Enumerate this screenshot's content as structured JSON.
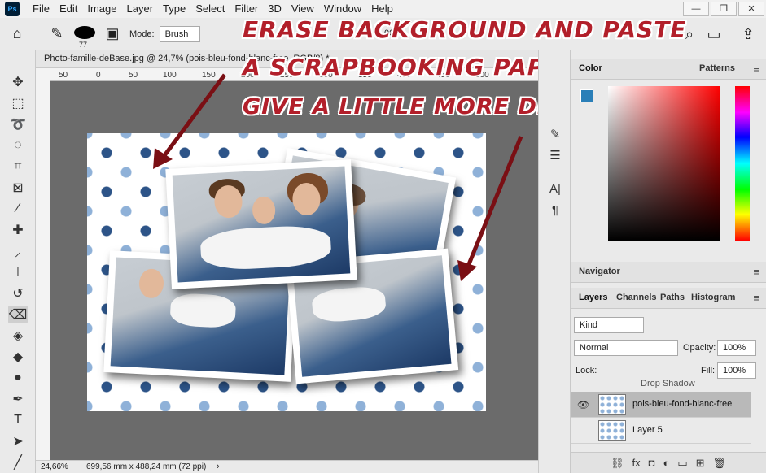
{
  "app": {
    "logo": "Ps"
  },
  "menu": [
    "File",
    "Edit",
    "Image",
    "Layer",
    "Type",
    "Select",
    "Filter",
    "3D",
    "View",
    "Window",
    "Help"
  ],
  "window_controls": {
    "minimize": "—",
    "restore": "❐",
    "close": "✕"
  },
  "options_bar": {
    "home_icon": "home-icon",
    "tool_icon": "eraser-icon",
    "brush_size": "77",
    "mode_label": "Mode:",
    "mode_value": "Brush",
    "flow_fragment": "00"
  },
  "document": {
    "tab_label": "Photo-famille-deBase.jpg @ 24,7% (pois-bleu-fond-blanc-free, RGB/8) *",
    "ruler_ticks": [
      "50",
      "0",
      "50",
      "100",
      "150",
      "200",
      "250",
      "300",
      "350",
      "400",
      "450",
      "500"
    ],
    "zoom": "24,66%",
    "dimensions": "699,56 mm x 488,24 mm (72 ppi)",
    "status_arrow": "›"
  },
  "annotation": {
    "line1": "ERASE BACKGROUND AND PASTE",
    "line2": "A SCRAPBOOKING PAPER BEHIND,",
    "line3": "GIVE A LITTLE MORE DROP SHADOW...",
    "color": "#b21f2a"
  },
  "color_panel": {
    "tabs": [
      "Color",
      "Patterns"
    ],
    "menu_icon": "≡"
  },
  "navigator": {
    "title": "Navigator",
    "menu_icon": "≡"
  },
  "layers_panel": {
    "tabs": [
      "Layers",
      "Channels",
      "Paths",
      "Histogram"
    ],
    "filter_kind": "Kind",
    "blend_mode": "Normal",
    "opacity_label": "Opacity:",
    "opacity_value": "100%",
    "lock_label": "Lock:",
    "fill_label": "Fill:",
    "fill_value": "100%",
    "effect_label": "Drop Shadow",
    "layers": [
      {
        "name": "pois-bleu-fond-blanc-free",
        "visible": true,
        "selected": true
      },
      {
        "name": "Layer 5",
        "visible": false,
        "selected": false
      }
    ],
    "bottom_icons": [
      "link-icon",
      "fx-icon",
      "mask-icon",
      "adjustment-icon",
      "group-icon",
      "new-layer-icon",
      "trash-icon"
    ],
    "fx_label": "fx"
  }
}
